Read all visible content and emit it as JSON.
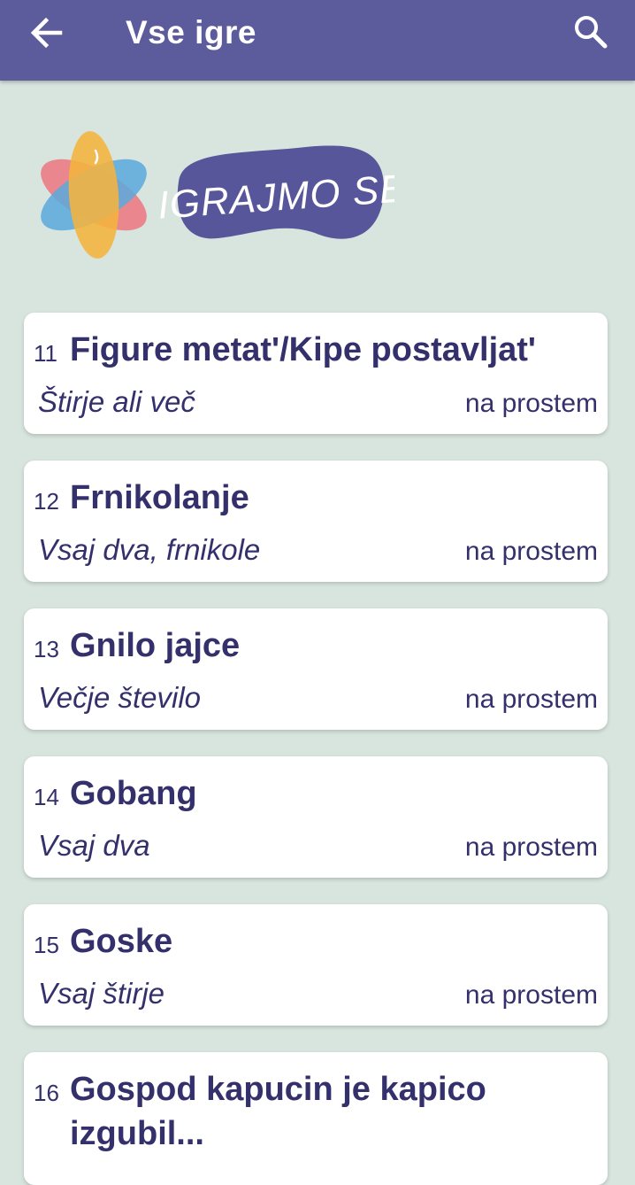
{
  "appbar": {
    "title": "Vse igre",
    "back_icon": "arrow-left-icon",
    "search_icon": "search-icon",
    "color": "#5c5b9c"
  },
  "logo": {
    "text": "IGRAJMO SE",
    "colors": [
      "#ec7b84",
      "#5aa9dd",
      "#f4b43e",
      "#58569b"
    ]
  },
  "games": [
    {
      "number": "11",
      "name": "Figure metat'/Kipe postavljat'",
      "players": "Štirje ali več",
      "place": "na prostem"
    },
    {
      "number": "12",
      "name": "Frnikolanje",
      "players": "Vsaj dva, frnikole",
      "place": "na prostem"
    },
    {
      "number": "13",
      "name": "Gnilo jajce",
      "players": "Večje število",
      "place": "na prostem"
    },
    {
      "number": "14",
      "name": "Gobang",
      "players": "Vsaj dva",
      "place": "na prostem"
    },
    {
      "number": "15",
      "name": "Goske",
      "players": "Vsaj štirje",
      "place": "na prostem"
    },
    {
      "number": "16",
      "name": "Gospod kapucin je kapico izgubil...",
      "players": "",
      "place": ""
    }
  ]
}
